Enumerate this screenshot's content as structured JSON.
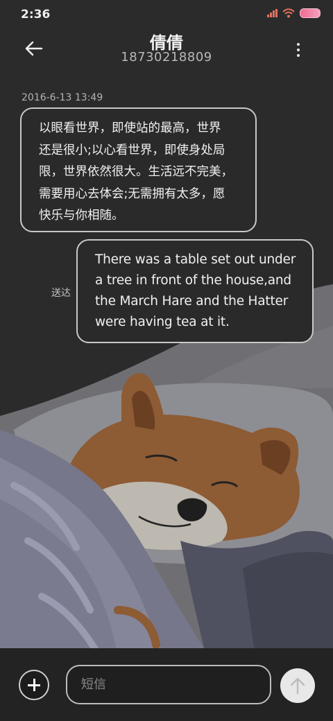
{
  "status_bar": {
    "time": "2:36"
  },
  "header": {
    "contact_name": "倩倩",
    "contact_number": "18730218809"
  },
  "conversation": {
    "timestamp": "2016-6-13 13:49",
    "messages": [
      {
        "direction": "incoming",
        "lines": [
          "以眼看世界，即使站的最高，世界",
          "还是很小;以心看世界，即使身处局",
          "限，世界依然很大。生活远不完美，",
          "需要用心去体会;无需拥有太多，愿",
          "快乐与你相随。"
        ]
      },
      {
        "direction": "outgoing",
        "lines": [
          "There was a table set out under",
          "a tree in front of the house,and",
          "the March Hare and the Hatter",
          "were having tea at it."
        ],
        "status": "送达"
      }
    ]
  },
  "composer": {
    "placeholder": "短信"
  },
  "icons": {
    "back": "back-arrow-icon",
    "menu": "more-vertical-icon",
    "add": "plus-icon",
    "send": "send-arrow-up-icon"
  },
  "colors": {
    "background": "#2b2b2b",
    "bubble_border": "#c9c9c9",
    "bottom_bar": "#232323",
    "send_button": "#e8e8e8",
    "battery": "#f06b8e",
    "signal": "#e2715e"
  }
}
